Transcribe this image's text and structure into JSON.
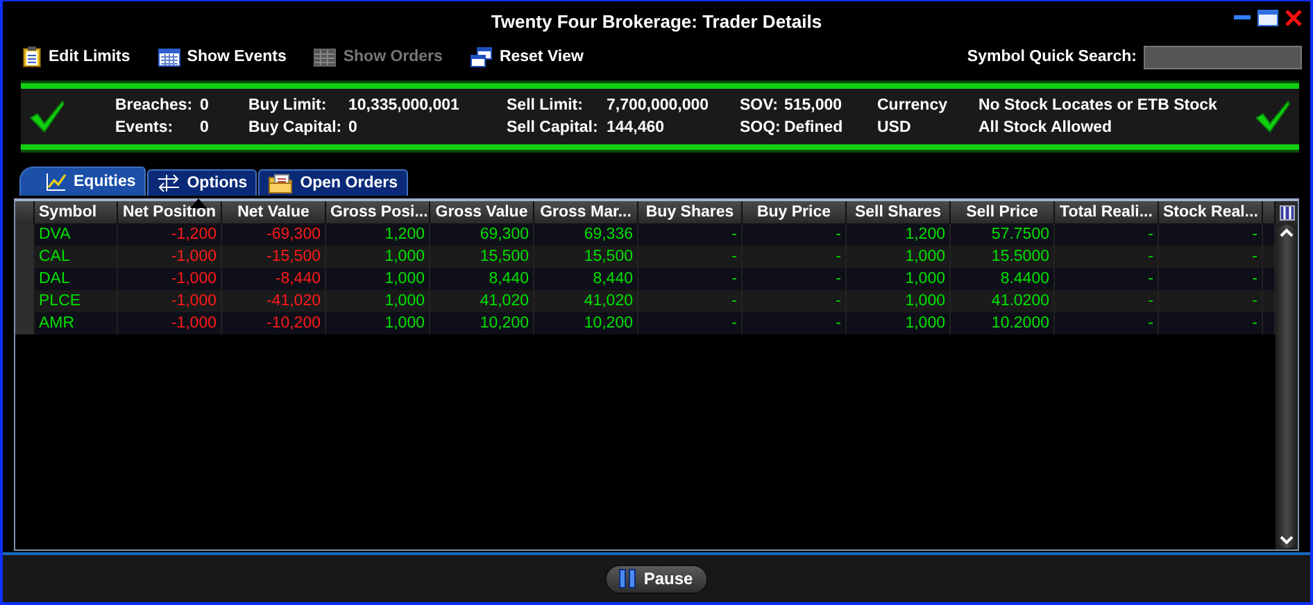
{
  "window": {
    "title": "Twenty Four Brokerage: Trader Details"
  },
  "toolbar": [
    {
      "kind": "edit",
      "label": "Edit Limits",
      "disabled": false
    },
    {
      "kind": "events",
      "label": "Show Events",
      "disabled": false
    },
    {
      "kind": "orders",
      "label": "Show Orders",
      "disabled": true
    },
    {
      "kind": "reset",
      "label": "Reset View",
      "disabled": false
    }
  ],
  "search": {
    "label": "Symbol Quick Search:"
  },
  "summary": {
    "rows": [
      [
        "Breaches:",
        "0",
        "Buy Limit:",
        "10,335,000,001",
        "Sell Limit:",
        "7,700,000,000",
        "SOV:",
        "515,000",
        "Currency",
        "No Stock Locates or ETB Stock"
      ],
      [
        "Events:",
        "0",
        "Buy Capital:",
        "0",
        "Sell Capital:",
        "144,460",
        "SOQ:",
        "Defined",
        "USD",
        "All Stock Allowed"
      ]
    ]
  },
  "tabs": [
    {
      "kind": "chart",
      "label": "Equities",
      "selected": true
    },
    {
      "kind": "arrows",
      "label": "Options",
      "selected": false
    },
    {
      "kind": "folder",
      "label": "Open Orders",
      "selected": false
    }
  ],
  "table": {
    "columns": [
      {
        "label": "Symbol",
        "sorted": false,
        "color": "#00e000"
      },
      {
        "label": "Net Position",
        "sorted": true,
        "color": "#ff1a1a"
      },
      {
        "label": "Net Value",
        "sorted": false,
        "color": "#ff1a1a"
      },
      {
        "label": "Gross Posi...",
        "sorted": false,
        "color": "#00e000"
      },
      {
        "label": "Gross Value",
        "sorted": false,
        "color": "#00e000"
      },
      {
        "label": "Gross Mar...",
        "sorted": false,
        "color": "#00e000"
      },
      {
        "label": "Buy Shares",
        "sorted": false,
        "color": "#00e000"
      },
      {
        "label": "Buy Price",
        "sorted": false,
        "color": "#00e000"
      },
      {
        "label": "Sell Shares",
        "sorted": false,
        "color": "#00e000"
      },
      {
        "label": "Sell Price",
        "sorted": false,
        "color": "#00e000"
      },
      {
        "label": "Total Reali...",
        "sorted": false,
        "color": "#00e000"
      },
      {
        "label": "Stock Real...",
        "sorted": false,
        "color": "#00e000"
      }
    ],
    "rows": [
      [
        "DVA",
        "-1,200",
        "-69,300",
        "1,200",
        "69,300",
        "69,336",
        "-",
        "-",
        "1,200",
        "57.7500",
        "-",
        "-"
      ],
      [
        "CAL",
        "-1,000",
        "-15,500",
        "1,000",
        "15,500",
        "15,500",
        "-",
        "-",
        "1,000",
        "15.5000",
        "-",
        "-"
      ],
      [
        "DAL",
        "-1,000",
        "-8,440",
        "1,000",
        "8,440",
        "8,440",
        "-",
        "-",
        "1,000",
        "8.4400",
        "-",
        "-"
      ],
      [
        "PLCE",
        "-1,000",
        "-41,020",
        "1,000",
        "41,020",
        "41,020",
        "-",
        "-",
        "1,000",
        "41.0200",
        "-",
        "-"
      ],
      [
        "AMR",
        "-1,000",
        "-10,200",
        "1,000",
        "10,200",
        "10,200",
        "-",
        "-",
        "1,000",
        "10.2000",
        "-",
        "-"
      ]
    ]
  },
  "footer": {
    "button": "Pause"
  }
}
